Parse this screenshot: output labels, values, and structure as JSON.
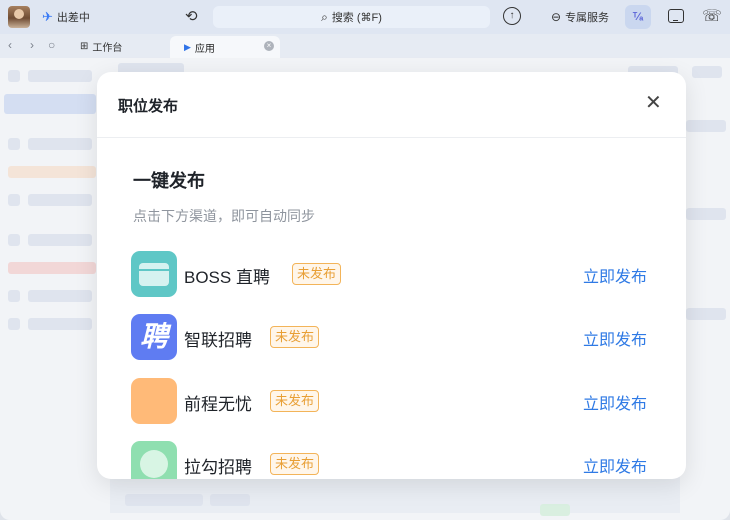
{
  "titlebar": {
    "status": "出差中",
    "search_label": "搜索 (⌘F)",
    "service_label": "专属服务",
    "translate_label": "ᵀ⁄ₐ"
  },
  "tabs": {
    "workbench_label": "工作台",
    "active_label": "应用",
    "close_symbol": "×"
  },
  "modal": {
    "title": "职位发布",
    "close_symbol": "✕",
    "section_title": "一键发布",
    "subtitle": "点击下方渠道，即可自动同步",
    "channels": [
      {
        "name": "BOSS 直聘",
        "status": "未发布",
        "action": "立即发布",
        "logo_text": ""
      },
      {
        "name": "智联招聘",
        "status": "未发布",
        "action": "立即发布",
        "logo_text": "聘"
      },
      {
        "name": "前程无忧",
        "status": "未发布",
        "action": "立即发布",
        "logo_text": ""
      },
      {
        "name": "拉勾招聘",
        "status": "未发布",
        "action": "立即发布",
        "logo_text": ""
      }
    ]
  },
  "colors": {
    "accent": "#2f7ae5",
    "badge": "#e89f35",
    "boss": "#5fc7c6",
    "zhilian": "#5f7cf2",
    "51job": "#ffba78",
    "lagou": "#8fdfb0"
  },
  "icons": [
    "avatar",
    "plane-icon",
    "history-icon",
    "search-icon",
    "upload-icon",
    "service-icon",
    "translate-icon",
    "screen-icon",
    "call-icon",
    "back-icon",
    "forward-icon",
    "refresh-icon",
    "grid-icon",
    "app-icon",
    "close-icon"
  ]
}
